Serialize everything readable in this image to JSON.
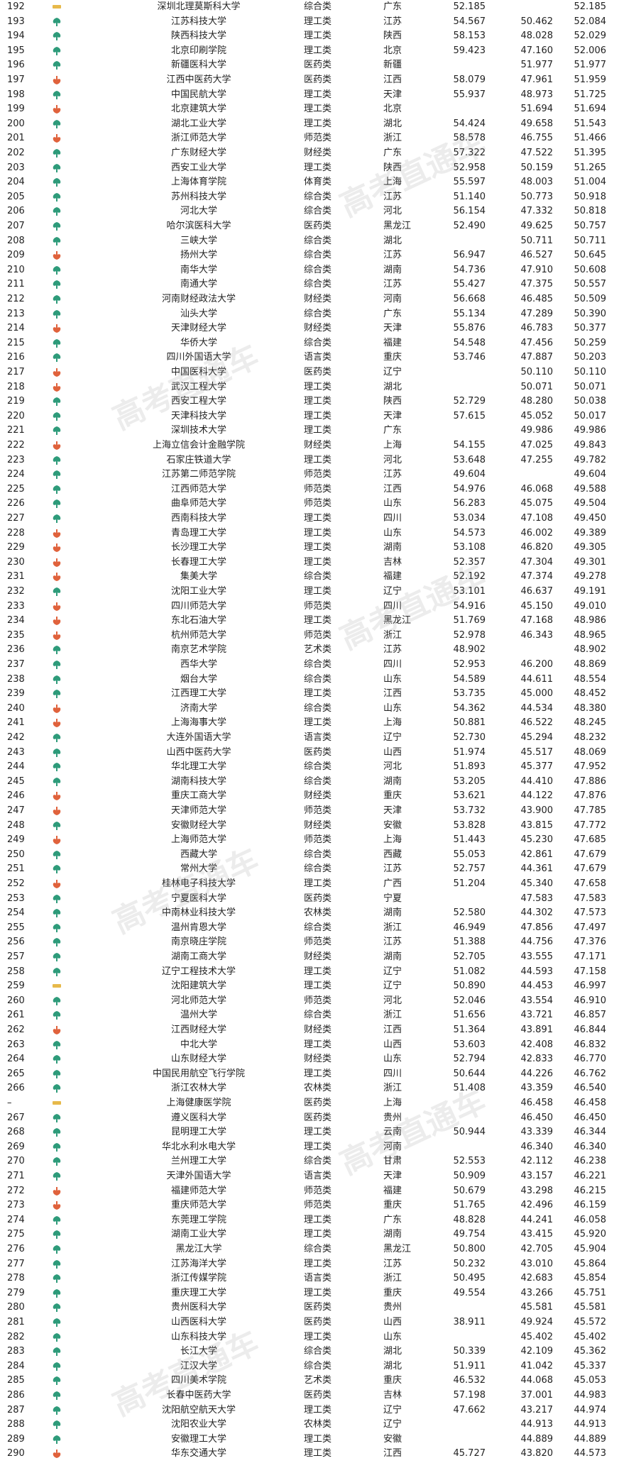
{
  "colors": {
    "up": "#2e9b7a",
    "down": "#e0623c",
    "flat": "#e7b94a"
  },
  "watermark": "高考直通车",
  "rows": [
    [
      "192",
      "flat",
      "深圳北理莫斯科大学",
      "综合类",
      "广东",
      "52.185",
      "",
      "52.185"
    ],
    [
      "193",
      "up",
      "江苏科技大学",
      "理工类",
      "江苏",
      "54.567",
      "50.462",
      "52.084"
    ],
    [
      "194",
      "up",
      "陕西科技大学",
      "理工类",
      "陕西",
      "58.153",
      "48.028",
      "52.029"
    ],
    [
      "195",
      "up",
      "北京印刷学院",
      "理工类",
      "北京",
      "59.423",
      "47.160",
      "52.006"
    ],
    [
      "196",
      "up",
      "新疆医科大学",
      "医药类",
      "新疆",
      "",
      "51.977",
      "51.977"
    ],
    [
      "197",
      "down",
      "江西中医药大学",
      "医药类",
      "江西",
      "58.079",
      "47.961",
      "51.959"
    ],
    [
      "198",
      "up",
      "中国民航大学",
      "理工类",
      "天津",
      "55.937",
      "48.973",
      "51.725"
    ],
    [
      "199",
      "down",
      "北京建筑大学",
      "理工类",
      "北京",
      "",
      "51.694",
      "51.694"
    ],
    [
      "200",
      "up",
      "湖北工业大学",
      "理工类",
      "湖北",
      "54.424",
      "49.658",
      "51.543"
    ],
    [
      "201",
      "down",
      "浙江师范大学",
      "师范类",
      "浙江",
      "58.578",
      "46.755",
      "51.466"
    ],
    [
      "202",
      "up",
      "广东财经大学",
      "财经类",
      "广东",
      "57.322",
      "47.522",
      "51.395"
    ],
    [
      "203",
      "up",
      "西安工业大学",
      "理工类",
      "陕西",
      "52.958",
      "50.159",
      "51.265"
    ],
    [
      "204",
      "up",
      "上海体育学院",
      "体育类",
      "上海",
      "55.597",
      "48.003",
      "51.004"
    ],
    [
      "205",
      "up",
      "苏州科技大学",
      "综合类",
      "江苏",
      "51.140",
      "50.773",
      "50.918"
    ],
    [
      "206",
      "up",
      "河北大学",
      "综合类",
      "河北",
      "56.154",
      "47.332",
      "50.818"
    ],
    [
      "207",
      "up",
      "哈尔滨医科大学",
      "医药类",
      "黑龙江",
      "52.490",
      "49.625",
      "50.757"
    ],
    [
      "208",
      "up",
      "三峡大学",
      "综合类",
      "湖北",
      "",
      "50.711",
      "50.711"
    ],
    [
      "209",
      "down",
      "扬州大学",
      "综合类",
      "江苏",
      "56.947",
      "46.527",
      "50.645"
    ],
    [
      "210",
      "up",
      "南华大学",
      "综合类",
      "湖南",
      "54.736",
      "47.910",
      "50.608"
    ],
    [
      "211",
      "up",
      "南通大学",
      "综合类",
      "江苏",
      "55.427",
      "47.375",
      "50.557"
    ],
    [
      "212",
      "up",
      "河南财经政法大学",
      "财经类",
      "河南",
      "56.668",
      "46.485",
      "50.509"
    ],
    [
      "213",
      "up",
      "汕头大学",
      "综合类",
      "广东",
      "55.134",
      "47.289",
      "50.390"
    ],
    [
      "214",
      "down",
      "天津财经大学",
      "财经类",
      "天津",
      "55.876",
      "46.783",
      "50.377"
    ],
    [
      "215",
      "up",
      "华侨大学",
      "综合类",
      "福建",
      "54.548",
      "47.456",
      "50.259"
    ],
    [
      "216",
      "up",
      "四川外国语大学",
      "语言类",
      "重庆",
      "53.746",
      "47.887",
      "50.203"
    ],
    [
      "217",
      "down",
      "中国医科大学",
      "医药类",
      "辽宁",
      "",
      "50.110",
      "50.110"
    ],
    [
      "218",
      "down",
      "武汉工程大学",
      "理工类",
      "湖北",
      "",
      "50.071",
      "50.071"
    ],
    [
      "219",
      "up",
      "西安工程大学",
      "理工类",
      "陕西",
      "52.729",
      "48.280",
      "50.038"
    ],
    [
      "220",
      "up",
      "天津科技大学",
      "理工类",
      "天津",
      "57.615",
      "45.052",
      "50.017"
    ],
    [
      "221",
      "up",
      "深圳技术大学",
      "理工类",
      "广东",
      "",
      "49.986",
      "49.986"
    ],
    [
      "222",
      "down",
      "上海立信会计金融学院",
      "财经类",
      "上海",
      "54.155",
      "47.025",
      "49.843"
    ],
    [
      "223",
      "up",
      "石家庄铁道大学",
      "理工类",
      "河北",
      "53.648",
      "47.255",
      "49.782"
    ],
    [
      "224",
      "up",
      "江苏第二师范学院",
      "师范类",
      "江苏",
      "49.604",
      "",
      "49.604"
    ],
    [
      "225",
      "up",
      "江西师范大学",
      "师范类",
      "江西",
      "54.976",
      "46.068",
      "49.588"
    ],
    [
      "226",
      "up",
      "曲阜师范大学",
      "师范类",
      "山东",
      "56.283",
      "45.075",
      "49.504"
    ],
    [
      "227",
      "up",
      "西南科技大学",
      "理工类",
      "四川",
      "53.034",
      "47.108",
      "49.450"
    ],
    [
      "228",
      "down",
      "青岛理工大学",
      "理工类",
      "山东",
      "54.573",
      "46.002",
      "49.389"
    ],
    [
      "229",
      "down",
      "长沙理工大学",
      "理工类",
      "湖南",
      "53.108",
      "46.820",
      "49.305"
    ],
    [
      "230",
      "down",
      "长春理工大学",
      "理工类",
      "吉林",
      "52.357",
      "47.304",
      "49.301"
    ],
    [
      "231",
      "down",
      "集美大学",
      "综合类",
      "福建",
      "52.192",
      "47.374",
      "49.278"
    ],
    [
      "232",
      "up",
      "沈阳工业大学",
      "理工类",
      "辽宁",
      "53.101",
      "46.637",
      "49.191"
    ],
    [
      "233",
      "down",
      "四川师范大学",
      "师范类",
      "四川",
      "54.916",
      "45.150",
      "49.010"
    ],
    [
      "234",
      "down",
      "东北石油大学",
      "理工类",
      "黑龙江",
      "51.769",
      "47.168",
      "48.986"
    ],
    [
      "235",
      "down",
      "杭州师范大学",
      "师范类",
      "浙江",
      "52.978",
      "46.343",
      "48.965"
    ],
    [
      "236",
      "up",
      "南京艺术学院",
      "艺术类",
      "江苏",
      "48.902",
      "",
      "48.902"
    ],
    [
      "237",
      "up",
      "西华大学",
      "综合类",
      "四川",
      "52.953",
      "46.200",
      "48.869"
    ],
    [
      "238",
      "up",
      "烟台大学",
      "综合类",
      "山东",
      "54.589",
      "44.611",
      "48.554"
    ],
    [
      "239",
      "up",
      "江西理工大学",
      "理工类",
      "江西",
      "53.735",
      "45.000",
      "48.452"
    ],
    [
      "240",
      "down",
      "济南大学",
      "综合类",
      "山东",
      "54.362",
      "44.534",
      "48.380"
    ],
    [
      "241",
      "down",
      "上海海事大学",
      "理工类",
      "上海",
      "50.881",
      "46.522",
      "48.245"
    ],
    [
      "242",
      "up",
      "大连外国语大学",
      "语言类",
      "辽宁",
      "52.730",
      "45.294",
      "48.232"
    ],
    [
      "243",
      "up",
      "山西中医药大学",
      "医药类",
      "山西",
      "51.974",
      "45.517",
      "48.069"
    ],
    [
      "244",
      "up",
      "华北理工大学",
      "综合类",
      "河北",
      "51.893",
      "45.377",
      "47.952"
    ],
    [
      "245",
      "up",
      "湖南科技大学",
      "综合类",
      "湖南",
      "53.205",
      "44.410",
      "47.886"
    ],
    [
      "246",
      "down",
      "重庆工商大学",
      "财经类",
      "重庆",
      "53.621",
      "44.122",
      "47.876"
    ],
    [
      "247",
      "down",
      "天津师范大学",
      "师范类",
      "天津",
      "53.732",
      "43.900",
      "47.785"
    ],
    [
      "248",
      "up",
      "安徽财经大学",
      "财经类",
      "安徽",
      "53.828",
      "43.815",
      "47.772"
    ],
    [
      "249",
      "down",
      "上海师范大学",
      "师范类",
      "上海",
      "51.443",
      "45.230",
      "47.685"
    ],
    [
      "250",
      "up",
      "西藏大学",
      "综合类",
      "西藏",
      "55.053",
      "42.861",
      "47.679"
    ],
    [
      "251",
      "up",
      "常州大学",
      "综合类",
      "江苏",
      "52.757",
      "44.361",
      "47.679"
    ],
    [
      "252",
      "down",
      "桂林电子科技大学",
      "理工类",
      "广西",
      "51.204",
      "45.340",
      "47.658"
    ],
    [
      "253",
      "up",
      "宁夏医科大学",
      "医药类",
      "宁夏",
      "",
      "47.583",
      "47.583"
    ],
    [
      "254",
      "up",
      "中南林业科技大学",
      "农林类",
      "湖南",
      "52.580",
      "44.302",
      "47.573"
    ],
    [
      "255",
      "up",
      "温州肯恩大学",
      "综合类",
      "浙江",
      "46.949",
      "47.856",
      "47.497"
    ],
    [
      "256",
      "up",
      "南京晓庄学院",
      "师范类",
      "江苏",
      "51.388",
      "44.756",
      "47.376"
    ],
    [
      "257",
      "up",
      "湖南工商大学",
      "财经类",
      "湖南",
      "52.705",
      "43.555",
      "47.171"
    ],
    [
      "258",
      "up",
      "辽宁工程技术大学",
      "理工类",
      "辽宁",
      "51.082",
      "44.593",
      "47.158"
    ],
    [
      "259",
      "flat",
      "沈阳建筑大学",
      "理工类",
      "辽宁",
      "50.890",
      "44.453",
      "46.997"
    ],
    [
      "260",
      "up",
      "河北师范大学",
      "师范类",
      "河北",
      "52.046",
      "43.554",
      "46.910"
    ],
    [
      "261",
      "up",
      "温州大学",
      "综合类",
      "浙江",
      "51.656",
      "43.721",
      "46.857"
    ],
    [
      "262",
      "down",
      "江西财经大学",
      "财经类",
      "江西",
      "51.364",
      "43.891",
      "46.844"
    ],
    [
      "263",
      "up",
      "中北大学",
      "理工类",
      "山西",
      "53.603",
      "42.408",
      "46.832"
    ],
    [
      "264",
      "up",
      "山东财经大学",
      "财经类",
      "山东",
      "52.794",
      "42.833",
      "46.770"
    ],
    [
      "265",
      "up",
      "中国民用航空飞行学院",
      "理工类",
      "四川",
      "50.644",
      "44.226",
      "46.762"
    ],
    [
      "266",
      "up",
      "浙江农林大学",
      "农林类",
      "浙江",
      "51.408",
      "43.359",
      "46.540"
    ],
    [
      "–",
      "flat",
      "上海健康医学院",
      "医药类",
      "上海",
      "",
      "46.458",
      "46.458"
    ],
    [
      "267",
      "up",
      "遵义医科大学",
      "医药类",
      "贵州",
      "",
      "46.450",
      "46.450"
    ],
    [
      "268",
      "up",
      "昆明理工大学",
      "理工类",
      "云南",
      "50.944",
      "43.339",
      "46.344"
    ],
    [
      "269",
      "up",
      "华北水利水电大学",
      "理工类",
      "河南",
      "",
      "46.340",
      "46.340"
    ],
    [
      "270",
      "up",
      "兰州理工大学",
      "综合类",
      "甘肃",
      "52.553",
      "42.112",
      "46.238"
    ],
    [
      "271",
      "up",
      "天津外国语大学",
      "语言类",
      "天津",
      "50.909",
      "43.157",
      "46.221"
    ],
    [
      "272",
      "down",
      "福建师范大学",
      "师范类",
      "福建",
      "50.679",
      "43.298",
      "46.215"
    ],
    [
      "273",
      "down",
      "重庆师范大学",
      "师范类",
      "重庆",
      "51.765",
      "42.496",
      "46.159"
    ],
    [
      "274",
      "up",
      "东莞理工学院",
      "理工类",
      "广东",
      "48.828",
      "44.241",
      "46.058"
    ],
    [
      "275",
      "up",
      "湖南工业大学",
      "理工类",
      "湖南",
      "49.754",
      "43.415",
      "45.920"
    ],
    [
      "276",
      "up",
      "黑龙江大学",
      "综合类",
      "黑龙江",
      "50.800",
      "42.705",
      "45.904"
    ],
    [
      "277",
      "up",
      "江苏海洋大学",
      "理工类",
      "江苏",
      "50.232",
      "43.010",
      "45.864"
    ],
    [
      "278",
      "up",
      "浙江传媒学院",
      "语言类",
      "浙江",
      "50.495",
      "42.683",
      "45.854"
    ],
    [
      "279",
      "up",
      "重庆理工大学",
      "理工类",
      "重庆",
      "49.554",
      "43.266",
      "45.751"
    ],
    [
      "280",
      "up",
      "贵州医科大学",
      "医药类",
      "贵州",
      "",
      "45.581",
      "45.581"
    ],
    [
      "281",
      "up",
      "山西医科大学",
      "医药类",
      "山西",
      "38.911",
      "49.924",
      "45.572"
    ],
    [
      "282",
      "up",
      "山东科技大学",
      "理工类",
      "山东",
      "",
      "45.402",
      "45.402"
    ],
    [
      "283",
      "up",
      "长江大学",
      "综合类",
      "湖北",
      "50.339",
      "42.109",
      "45.362"
    ],
    [
      "284",
      "up",
      "江汉大学",
      "综合类",
      "湖北",
      "51.911",
      "41.042",
      "45.337"
    ],
    [
      "285",
      "up",
      "四川美术学院",
      "艺术类",
      "重庆",
      "46.532",
      "44.068",
      "45.053"
    ],
    [
      "286",
      "up",
      "长春中医药大学",
      "医药类",
      "吉林",
      "57.198",
      "37.001",
      "44.983"
    ],
    [
      "287",
      "up",
      "沈阳航空航天大学",
      "理工类",
      "辽宁",
      "47.662",
      "43.217",
      "44.974"
    ],
    [
      "288",
      "up",
      "沈阳农业大学",
      "农林类",
      "辽宁",
      "",
      "44.913",
      "44.913"
    ],
    [
      "289",
      "up",
      "安徽理工大学",
      "理工类",
      "安徽",
      "",
      "44.889",
      "44.889"
    ],
    [
      "290",
      "down",
      "华东交通大学",
      "理工类",
      "江西",
      "45.727",
      "43.820",
      "44.573"
    ]
  ]
}
